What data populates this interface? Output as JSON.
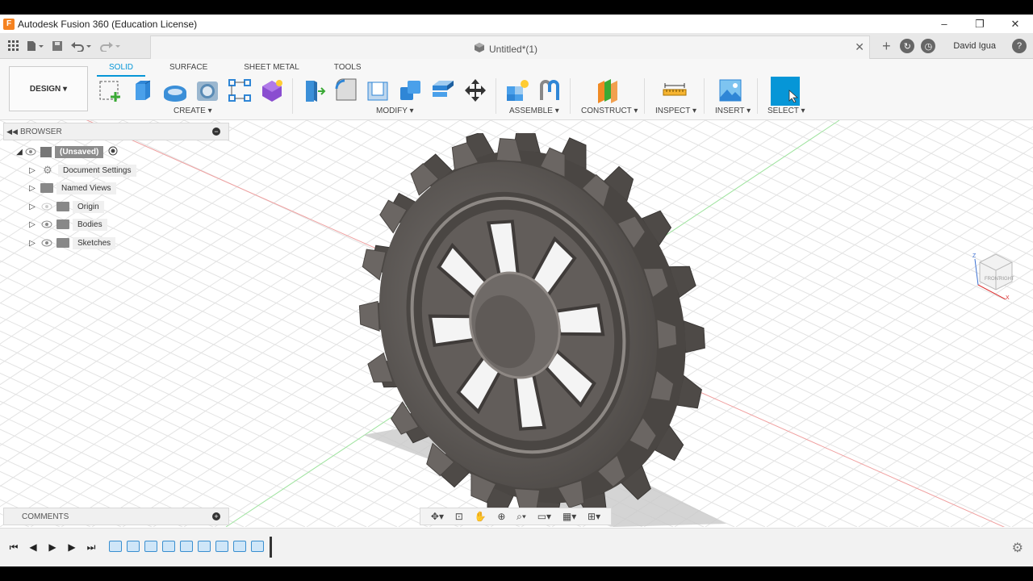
{
  "window": {
    "title": "Autodesk Fusion 360 (Education License)",
    "logo_letter": "F",
    "minimize": "–",
    "maximize": "❐",
    "close": "✕"
  },
  "quickbar": {
    "document_title": "Untitled*(1)",
    "user_name": "David Igua",
    "tab_close": "✕"
  },
  "ribbon": {
    "workspace_label": "DESIGN ▾",
    "tabs": [
      "SOLID",
      "SURFACE",
      "SHEET METAL",
      "TOOLS"
    ],
    "active_tab": "SOLID",
    "groups": {
      "create": "CREATE ▾",
      "modify": "MODIFY ▾",
      "assemble": "ASSEMBLE ▾",
      "construct": "CONSTRUCT ▾",
      "inspect": "INSPECT ▾",
      "insert": "INSERT ▾",
      "select": "SELECT ▾"
    }
  },
  "browser": {
    "title": "BROWSER",
    "root": "(Unsaved)",
    "items": [
      "Document Settings",
      "Named Views",
      "Origin",
      "Bodies",
      "Sketches"
    ]
  },
  "comments": {
    "title": "COMMENTS"
  },
  "colors": {
    "accent": "#0696d7",
    "gear": "#5e5a57",
    "grid": "#e3e3e3"
  },
  "icons": {
    "grid_menu": "apps-grid-icon",
    "file": "file-icon",
    "save": "save-icon",
    "undo": "undo-icon",
    "redo": "redo-icon"
  }
}
